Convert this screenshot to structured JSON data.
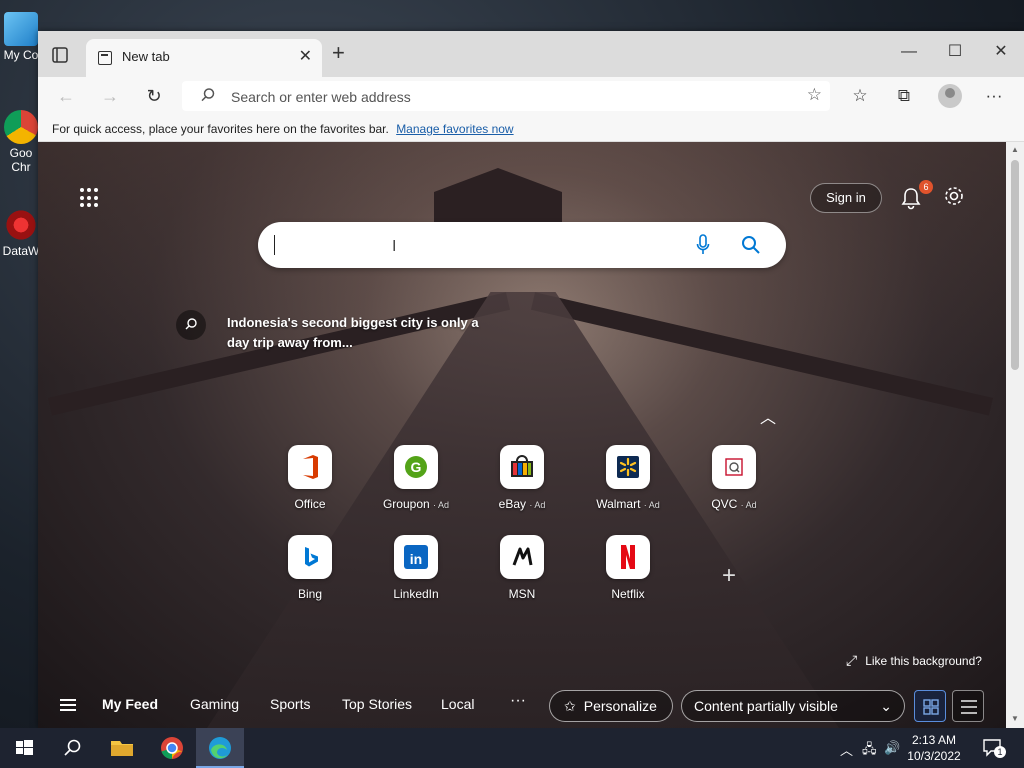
{
  "desktop": {
    "icons": [
      {
        "label": "My Co",
        "name": "desktop-icon-my-computer"
      },
      {
        "label": "Goo Chr",
        "name": "desktop-icon-google-chrome"
      },
      {
        "label": "DataW",
        "name": "desktop-icon-dataw"
      }
    ]
  },
  "browser": {
    "tab": {
      "title": "New tab"
    },
    "address": {
      "placeholder": "Search or enter web address"
    },
    "favorites_bar": {
      "message": "For quick access, place your favorites here on the favorites bar.",
      "link": "Manage favorites now"
    }
  },
  "ntp": {
    "sign_in": "Sign in",
    "notification_count": "6",
    "tip": "Indonesia's second biggest city is only a day trip away from...",
    "tiles": [
      {
        "label": "Office",
        "ad": "",
        "icon": "office-icon",
        "color": "#d83b01"
      },
      {
        "label": "Groupon",
        "ad": "· Ad",
        "icon": "groupon-icon",
        "color": "#53a318"
      },
      {
        "label": "eBay",
        "ad": "· Ad",
        "icon": "ebay-icon",
        "color": "#e53238"
      },
      {
        "label": "Walmart",
        "ad": "· Ad",
        "icon": "walmart-icon",
        "color": "#0071ce"
      },
      {
        "label": "QVC",
        "ad": "· Ad",
        "icon": "qvc-icon",
        "color": "#c8102e"
      },
      {
        "label": "Bing",
        "ad": "",
        "icon": "bing-icon",
        "color": "#0078d4"
      },
      {
        "label": "LinkedIn",
        "ad": "",
        "icon": "linkedin-icon",
        "color": "#0a66c2"
      },
      {
        "label": "MSN",
        "ad": "",
        "icon": "msn-icon",
        "color": "#111111"
      },
      {
        "label": "Netflix",
        "ad": "",
        "icon": "netflix-icon",
        "color": "#e50914"
      }
    ],
    "like_background": "Like this background?",
    "feed_tabs": [
      "My Feed",
      "Gaming",
      "Sports",
      "Top Stories",
      "Local"
    ],
    "more": "···",
    "personalize": "Personalize",
    "content_visibility": "Content partially visible"
  },
  "taskbar": {
    "time": "2:13 AM",
    "date": "10/3/2022",
    "notification_count": "1"
  },
  "colors": {
    "accent": "#0078d4",
    "badge": "#e0532c"
  }
}
